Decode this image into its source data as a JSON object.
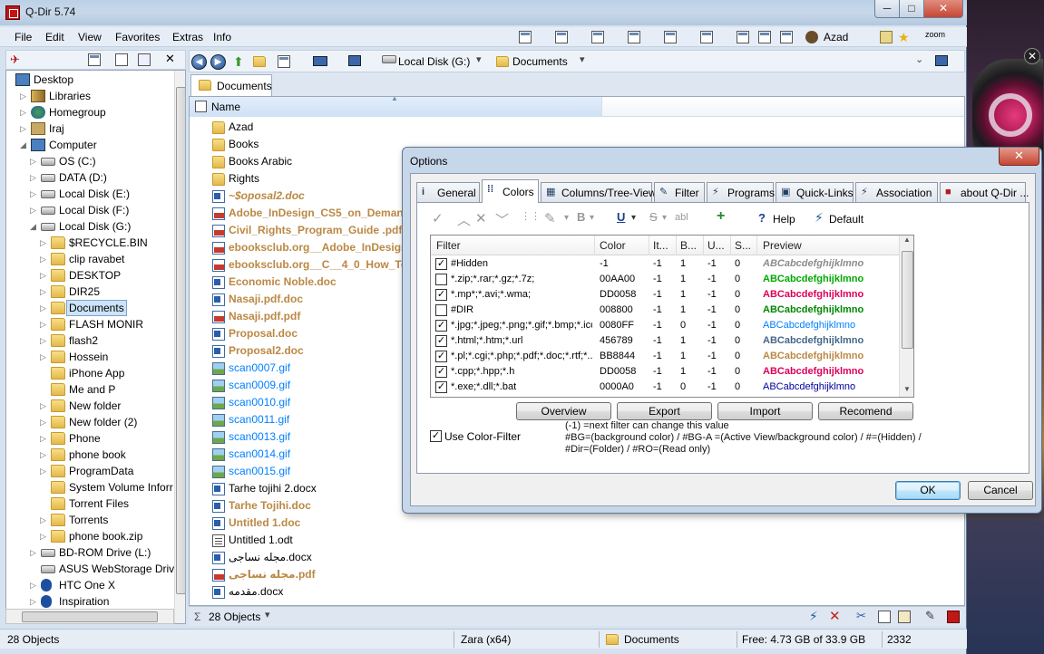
{
  "window": {
    "title": "Q-Dir 5.74",
    "caption_min": "─",
    "caption_max": "□",
    "caption_close": "✕"
  },
  "menu": [
    "File",
    "Edit",
    "View",
    "Favorites",
    "Extras",
    "Info"
  ],
  "toolbar": {
    "user_label": "Azad",
    "zoom_label": "zoom"
  },
  "address": {
    "drive": "Local Disk (G:)",
    "folder": "Documents"
  },
  "tab": {
    "label": "Documents"
  },
  "columns": {
    "name": "Name"
  },
  "tree": {
    "items": [
      {
        "label": "Desktop",
        "icon": "desktop-icon",
        "level": 0,
        "arrow": ""
      },
      {
        "label": "Libraries",
        "icon": "library-icon",
        "level": 1,
        "arrow": "▷"
      },
      {
        "label": "Homegroup",
        "icon": "homegroup-icon",
        "level": 1,
        "arrow": "▷"
      },
      {
        "label": "Iraj",
        "icon": "user-folder-icon",
        "level": 1,
        "arrow": "▷"
      },
      {
        "label": "Computer",
        "icon": "computer-icon",
        "level": 1,
        "arrow": "◢"
      },
      {
        "label": "OS (C:)",
        "icon": "drive-icon",
        "level": 2,
        "arrow": "▷"
      },
      {
        "label": "DATA (D:)",
        "icon": "drive-icon",
        "level": 2,
        "arrow": "▷"
      },
      {
        "label": "Local Disk (E:)",
        "icon": "drive-icon",
        "level": 2,
        "arrow": "▷"
      },
      {
        "label": "Local Disk (F:)",
        "icon": "drive-icon",
        "level": 2,
        "arrow": "▷"
      },
      {
        "label": "Local Disk (G:)",
        "icon": "drive-icon",
        "level": 2,
        "arrow": "◢"
      },
      {
        "label": "$RECYCLE.BIN",
        "icon": "folder-icon",
        "level": 3,
        "arrow": "▷"
      },
      {
        "label": "clip ravabet",
        "icon": "folder-icon",
        "level": 3,
        "arrow": "▷"
      },
      {
        "label": "DESKTOP",
        "icon": "folder-icon",
        "level": 3,
        "arrow": "▷"
      },
      {
        "label": "DIR25",
        "icon": "folder-icon",
        "level": 3,
        "arrow": "▷"
      },
      {
        "label": "Documents",
        "icon": "folder-icon",
        "level": 3,
        "arrow": "▷",
        "selected": true
      },
      {
        "label": "FLASH MONIR",
        "icon": "folder-icon",
        "level": 3,
        "arrow": "▷"
      },
      {
        "label": "flash2",
        "icon": "folder-icon",
        "level": 3,
        "arrow": "▷"
      },
      {
        "label": "Hossein",
        "icon": "folder-icon",
        "level": 3,
        "arrow": "▷"
      },
      {
        "label": "iPhone App",
        "icon": "folder-icon",
        "level": 3,
        "arrow": ""
      },
      {
        "label": "Me and P",
        "icon": "folder-icon",
        "level": 3,
        "arrow": ""
      },
      {
        "label": "New folder",
        "icon": "folder-icon",
        "level": 3,
        "arrow": "▷"
      },
      {
        "label": "New folder (2)",
        "icon": "folder-icon",
        "level": 3,
        "arrow": "▷"
      },
      {
        "label": "Phone",
        "icon": "folder-icon",
        "level": 3,
        "arrow": "▷"
      },
      {
        "label": "phone book",
        "icon": "folder-icon",
        "level": 3,
        "arrow": "▷"
      },
      {
        "label": "ProgramData",
        "icon": "folder-icon",
        "level": 3,
        "arrow": "▷"
      },
      {
        "label": "System Volume Inforr",
        "icon": "folder-icon",
        "level": 3,
        "arrow": ""
      },
      {
        "label": "Torrent Files",
        "icon": "folder-icon",
        "level": 3,
        "arrow": ""
      },
      {
        "label": "Torrents",
        "icon": "folder-icon",
        "level": 3,
        "arrow": "▷"
      },
      {
        "label": "phone book.zip",
        "icon": "folder-icon",
        "level": 3,
        "arrow": "▷"
      },
      {
        "label": "BD-ROM Drive (L:)",
        "icon": "drive-icon",
        "level": 2,
        "arrow": "▷"
      },
      {
        "label": "ASUS WebStorage Drive",
        "icon": "drive-icon",
        "level": 2,
        "arrow": ""
      },
      {
        "label": "HTC One X",
        "icon": "bluetooth-icon",
        "level": 2,
        "arrow": "▷"
      },
      {
        "label": "Inspiration",
        "icon": "bluetooth-icon",
        "level": 2,
        "arrow": "▷"
      }
    ]
  },
  "files": [
    {
      "name": "Azad",
      "type": "folder",
      "color": "#000000"
    },
    {
      "name": "Books",
      "type": "folder",
      "color": "#000000"
    },
    {
      "name": "Books Arabic",
      "type": "folder",
      "color": "#000000"
    },
    {
      "name": "Rights",
      "type": "folder",
      "color": "#000000"
    },
    {
      "name": "~$oposal2.doc",
      "type": "doc",
      "color": "#BB8844",
      "italic": true
    },
    {
      "name": "Adobe_InDesign_CS5_on_Demand.",
      "type": "pdf",
      "color": "#BB8844"
    },
    {
      "name": "Civil_Rights_Program_Guide .pdf",
      "type": "pdf",
      "color": "#BB8844"
    },
    {
      "name": "ebooksclub.org__Adobe_InDesign_C",
      "type": "pdf",
      "color": "#BB8844"
    },
    {
      "name": "ebooksclub.org__C__4_0_How_To.pd",
      "type": "pdf",
      "color": "#BB8844"
    },
    {
      "name": "Economic Noble.doc",
      "type": "doc",
      "color": "#BB8844"
    },
    {
      "name": "Nasaji.pdf.doc",
      "type": "doc",
      "color": "#BB8844"
    },
    {
      "name": "Nasaji.pdf.pdf",
      "type": "pdf",
      "color": "#BB8844"
    },
    {
      "name": "Proposal.doc",
      "type": "doc",
      "color": "#BB8844"
    },
    {
      "name": "Proposal2.doc",
      "type": "doc",
      "color": "#BB8844"
    },
    {
      "name": "scan0007.gif",
      "type": "gif",
      "color": "#0080FF"
    },
    {
      "name": "scan0009.gif",
      "type": "gif",
      "color": "#0080FF"
    },
    {
      "name": "scan0010.gif",
      "type": "gif",
      "color": "#0080FF"
    },
    {
      "name": "scan0011.gif",
      "type": "gif",
      "color": "#0080FF"
    },
    {
      "name": "scan0013.gif",
      "type": "gif",
      "color": "#0080FF"
    },
    {
      "name": "scan0014.gif",
      "type": "gif",
      "color": "#0080FF"
    },
    {
      "name": "scan0015.gif",
      "type": "gif",
      "color": "#0080FF"
    },
    {
      "name": "Tarhe tojihi 2.docx",
      "type": "doc",
      "color": "#000000"
    },
    {
      "name": "Tarhe Tojihi.doc",
      "type": "doc",
      "color": "#BB8844"
    },
    {
      "name": "Untitled 1.doc",
      "type": "doc",
      "color": "#BB8844"
    },
    {
      "name": "Untitled 1.odt",
      "type": "odt",
      "color": "#000000"
    },
    {
      "name": "مجله نساجی.docx",
      "type": "doc",
      "color": "#000000"
    },
    {
      "name": "مجله نساجی.pdf",
      "type": "pdf",
      "color": "#BB8844"
    },
    {
      "name": "مقدمه.docx",
      "type": "doc",
      "color": "#000000"
    }
  ],
  "file_status": {
    "count_label": "28 Objects",
    "sigma": "Σ"
  },
  "status": {
    "objects": "28 Objects",
    "user": "Zara (x64)",
    "folder": "Documents",
    "free": "Free: 4.73 GB of 33.9 GB",
    "number": "2332"
  },
  "dialog": {
    "title": "Options",
    "close": "✕",
    "tabs": [
      {
        "label": "General",
        "icon": "info-icon"
      },
      {
        "label": "Colors",
        "icon": "colors-icon",
        "active": true
      },
      {
        "label": "Columns/Tree-View",
        "icon": "columns-icon"
      },
      {
        "label": "Filter",
        "icon": "filter-icon"
      },
      {
        "label": "Programs",
        "icon": "programs-icon"
      },
      {
        "label": "Quick-Links",
        "icon": "quicklinks-icon"
      },
      {
        "label": "Association",
        "icon": "association-icon"
      },
      {
        "label": "about Q-Dir ...",
        "icon": "about-icon"
      }
    ],
    "toolbar": {
      "help": "Help",
      "default": "Default"
    },
    "table": {
      "headers": [
        "Filter",
        "Color",
        "It...",
        "B...",
        "U...",
        "S...",
        "Preview"
      ],
      "rows": [
        {
          "checked": true,
          "filter": "#Hidden",
          "color": "-1",
          "it": "-1",
          "b": "1",
          "u": "-1",
          "s": "0",
          "preview": "ABCabcdefghijklmno",
          "pcolor": "#8C8C8C",
          "italic": true
        },
        {
          "checked": false,
          "filter": "*.zip;*.rar;*.gz;*.7z;",
          "color": "00AA00",
          "it": "-1",
          "b": "1",
          "u": "-1",
          "s": "0",
          "preview": "ABCabcdefghijklmno",
          "pcolor": "#00AA00"
        },
        {
          "checked": true,
          "filter": "*.mp*;*.avi;*.wma;",
          "color": "DD0058",
          "it": "-1",
          "b": "1",
          "u": "-1",
          "s": "0",
          "preview": "ABCabcdefghijklmno",
          "pcolor": "#DD0058"
        },
        {
          "checked": false,
          "filter": "#DIR",
          "color": "008800",
          "it": "-1",
          "b": "1",
          "u": "-1",
          "s": "0",
          "preview": "ABCabcdefghijklmno",
          "pcolor": "#008800"
        },
        {
          "checked": true,
          "filter": "*.jpg;*.jpeg;*.png;*.gif;*.bmp;*.ico",
          "color": "0080FF",
          "it": "-1",
          "b": "0",
          "u": "-1",
          "s": "0",
          "preview": "ABCabcdefghijklmno",
          "pcolor": "#0080FF",
          "normal": true
        },
        {
          "checked": true,
          "filter": "*.html;*.htm;*.url",
          "color": "456789",
          "it": "-1",
          "b": "1",
          "u": "-1",
          "s": "0",
          "preview": "ABCabcdefghijklmno",
          "pcolor": "#456789"
        },
        {
          "checked": true,
          "filter": "*.pl;*.cgi;*.php;*.pdf;*.doc;*.rtf;*...",
          "color": "BB8844",
          "it": "-1",
          "b": "1",
          "u": "-1",
          "s": "0",
          "preview": "ABCabcdefghijklmno",
          "pcolor": "#BB8844"
        },
        {
          "checked": true,
          "filter": "*.cpp;*.hpp;*.h",
          "color": "DD0058",
          "it": "-1",
          "b": "1",
          "u": "-1",
          "s": "0",
          "preview": "ABCabcdefghijklmno",
          "pcolor": "#DD0058"
        },
        {
          "checked": true,
          "filter": "*.exe;*.dll;*.bat",
          "color": "0000A0",
          "it": "-1",
          "b": "0",
          "u": "-1",
          "s": "0",
          "preview": "ABCabcdefghijklmno",
          "pcolor": "#0000A0",
          "normal": true
        }
      ]
    },
    "buttons": {
      "overview": "Overview",
      "export": "Export",
      "import": "Import",
      "recomend": "Recomend",
      "ok": "OK",
      "cancel": "Cancel"
    },
    "use_color_filter": {
      "label": "Use Color-Filter",
      "checked": true
    },
    "help_lines": [
      "(-1) =next filter can change this value",
      "#BG=(background color) / #BG-A =(Active View/background color) / #=(Hidden) /",
      "#Dir=(Folder) / #RO=(Read only)"
    ]
  }
}
